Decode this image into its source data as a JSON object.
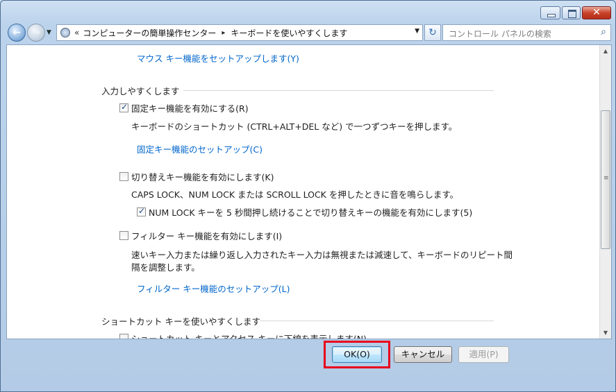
{
  "window": {
    "caption_buttons": {
      "minimize": "minimize",
      "maximize": "maximize",
      "close": "✕"
    }
  },
  "navbar": {
    "back_glyph": "←",
    "forward_glyph": "→",
    "breadcrumb_chevron": "«",
    "breadcrumbs": [
      "コンピューターの簡単操作センター",
      "キーボードを使いやすくします"
    ],
    "breadcrumb_separator": "▸",
    "refresh_glyph": "↻",
    "search_placeholder": "コントロール パネルの検索"
  },
  "content": {
    "mouse_link": "マウス キー機能をセットアップします(Y)",
    "section_typing": "入力しやすくします",
    "sticky_keys": {
      "label": "固定キー機能を有効にする(R)",
      "checked": true
    },
    "sticky_desc": "キーボードのショートカット (CTRL+ALT+DEL など) で一つずつキーを押します。",
    "sticky_setup_link": "固定キー機能のセットアップ(C)",
    "toggle_keys": {
      "label": "切り替えキー機能を有効にします(K)",
      "checked": false
    },
    "toggle_desc": "CAPS LOCK、NUM LOCK または SCROLL LOCK を押したときに音を鳴らします。",
    "numlock_option": {
      "label": "NUM LOCK キーを 5 秒間押し続けることで切り替えキーの機能を有効にします(5)",
      "checked": true
    },
    "filter_keys": {
      "label": "フィルター キー機能を有効にします(I)",
      "checked": false
    },
    "filter_desc_line1": "速いキー入力または繰り返し入力されたキー入力は無視または減速して、キーボードのリピート間",
    "filter_desc_line2": "隔を調整します。",
    "filter_setup_link": "フィルター キー機能のセットアップ(L)",
    "section_shortcut": "ショートカット キーを使いやすくします",
    "underline_option": {
      "label": "ショートカット キーとアクセス キーに下線を表示します(N)",
      "checked": false
    }
  },
  "buttons": {
    "ok": "OK(O)",
    "cancel": "キャンセル",
    "apply": "適用(P)"
  },
  "colors": {
    "link": "#0066cc",
    "highlight": "#e8001c"
  }
}
